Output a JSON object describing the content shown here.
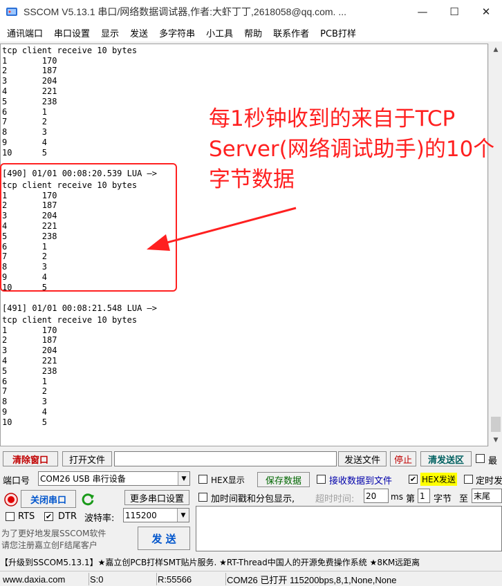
{
  "window": {
    "title": "SSCOM V5.13.1 串口/网络数据调试器,作者:大虾丁丁,2618058@qq.com. ...",
    "minimize_glyph": "—",
    "maximize_glyph": "☐",
    "close_glyph": "✕"
  },
  "menu": [
    "通讯端口",
    "串口设置",
    "显示",
    "发送",
    "多字符串",
    "小工具",
    "帮助",
    "联系作者",
    "PCB打样"
  ],
  "output_lines": [
    "tcp client receive 10 bytes",
    "1       170",
    "2       187",
    "3       204",
    "4       221",
    "5       238",
    "6       1",
    "7       2",
    "8       3",
    "9       4",
    "10      5",
    "",
    "[490] 01/01 00:08:20.539 LUA —>",
    "tcp client receive 10 bytes",
    "1       170",
    "2       187",
    "3       204",
    "4       221",
    "5       238",
    "6       1",
    "7       2",
    "8       3",
    "9       4",
    "10      5",
    "",
    "[491] 01/01 00:08:21.548 LUA —>",
    "tcp client receive 10 bytes",
    "1       170",
    "2       187",
    "3       204",
    "4       221",
    "5       238",
    "6       1",
    "7       2",
    "8       3",
    "9       4",
    "10      5"
  ],
  "annotation": {
    "text": "每1秒钟收到的来自于TCP Server(网络调试助手)的10个字节数据",
    "color": "#ff2020"
  },
  "toolbar": {
    "clear_window": "清除窗口",
    "open_file": "打开文件",
    "file_path": "",
    "send_file": "发送文件",
    "stop": "停止",
    "clear_send": "清发送区",
    "top_most": "最"
  },
  "port": {
    "label": "端口号",
    "value": "COM26 USB 串行设备",
    "close_port": "关闭串口",
    "more_settings": "更多串口设置",
    "rts_label": "RTS",
    "dtr_label": "DTR",
    "baud_label": "波特率:",
    "baud_value": "115200"
  },
  "options": {
    "hex_display": "HEX显示",
    "save_data": "保存数据",
    "recv_to_file": "接收数据到文件",
    "hex_send": "HEX发送",
    "timed_send": "定时发",
    "timestamp": "加时间戳和分包显示,",
    "timeout_label": "超时时间:",
    "timeout_value": "20",
    "timeout_unit": "ms",
    "byte_prefix": "第",
    "byte_index": "1",
    "byte_label": "字节",
    "to_label": "至",
    "end_value": "末尾"
  },
  "send": {
    "promo_line1": "为了更好地发展SSCOM软件",
    "promo_line2": "请您注册嘉立创F结尾客户",
    "send_button": "发 送",
    "input_value": ""
  },
  "promo_banner": "【升级到SSCOM5.13.1】★嘉立创PCB打样SMT贴片服务. ★RT-Thread中国人的开源免费操作系统 ★8KM远距离",
  "status": {
    "website": "www.daxia.com",
    "sent": "S:0",
    "received": "R:55566",
    "port_state": "COM26 已打开  115200bps,8,1,None,None"
  }
}
